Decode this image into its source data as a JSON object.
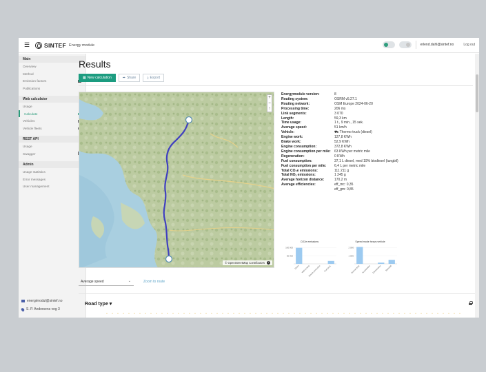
{
  "header": {
    "brand": "SINTEF",
    "module": "Energy module",
    "user": "erlend.dahl@sintef.no",
    "logout": "Log out"
  },
  "sidebar": {
    "sections": [
      {
        "title": "Main",
        "items": [
          {
            "label": "Overview"
          },
          {
            "label": "Method"
          },
          {
            "label": "Emission factors",
            "lock": "dark"
          },
          {
            "label": "Publications"
          }
        ]
      },
      {
        "title": "Web calculator",
        "items": [
          {
            "label": "Usage"
          },
          {
            "label": "Calculate",
            "lock": "green",
            "active": true
          },
          {
            "label": "Vehicles",
            "lock": "dark"
          },
          {
            "label": "Vehicle fleets",
            "lock": "dark"
          }
        ]
      },
      {
        "title": "REST API",
        "items": [
          {
            "label": "Usage"
          },
          {
            "label": "Swagger",
            "ext": true
          }
        ]
      },
      {
        "title": "Admin",
        "items": [
          {
            "label": "Usage statistics"
          },
          {
            "label": "Error messages"
          },
          {
            "label": "User management"
          }
        ]
      }
    ],
    "contact_email": "energimodul@sintef.no",
    "contact_address": "S. P. Andersens veg 3"
  },
  "main": {
    "title": "Results",
    "buttons": {
      "new_calc": "New calculation",
      "share": "Share",
      "export": "Export"
    },
    "map_attribution": "© OpenStreetMap Contributors",
    "speed_select": "Average speed",
    "zoom_link": "Zoom to route",
    "road_type": "Road type"
  },
  "results": [
    {
      "label": "Energymodule version:",
      "value": "8"
    },
    {
      "label": "Routing system:",
      "value": "OSRM v5.27.1"
    },
    {
      "label": "Routing network:",
      "value": "OSM Europe 2024-06-20"
    },
    {
      "label": "Processing time:",
      "value": "206 ms"
    },
    {
      "label": "Link segments:",
      "value": "3 070"
    },
    {
      "label": "Length:",
      "value": "59,3 km"
    },
    {
      "label": "Time usage:",
      "value": "1 t., 9 min., 15 sek."
    },
    {
      "label": "Average speed:",
      "value": "51 km/h"
    },
    {
      "label": "Vehicle:",
      "value": "Thermo truck (diesel)"
    },
    {
      "label": "Engine work:",
      "value": "127,8 KWh"
    },
    {
      "label": "Brake work:",
      "value": "52,9 KWh"
    },
    {
      "label": "Engine consumption:",
      "value": "372,8 KWh"
    },
    {
      "label": "Engine consumption per mile:",
      "value": "63 KWh per metric mile"
    },
    {
      "label": "Regeneration:",
      "value": "0 KWh"
    },
    {
      "label": "Fuel consumption:",
      "value": "37,1 L diesel, med 19% biodiesel (tungbil)"
    },
    {
      "label": "Fuel consumption per mile:",
      "value": "6,4 L per metric mile"
    },
    {
      "label": "Total CO₂e emissions:",
      "value": "111 211 g"
    },
    {
      "label": "Total NOₓ emissions:",
      "value": "1 245 g"
    },
    {
      "label": "Average horizon distance:",
      "value": "170,2 m"
    },
    {
      "label": "Average efficiencies:",
      "value": "eff_mc: 0,35"
    },
    {
      "label": "",
      "value": "eff_gm: 0,85"
    }
  ],
  "chart_data": [
    {
      "type": "bar",
      "title": "CO2e emissions",
      "categories": [
        "Direct",
        "Well-to-tank",
        "Vehicle production",
        "Fuel prod."
      ],
      "values": [
        100000,
        0,
        0,
        18000
      ],
      "yticks": [
        "100 000",
        "50 000"
      ],
      "ylim": [
        0,
        120000
      ]
    },
    {
      "type": "bar",
      "title": "Speed mode heavy vehicle",
      "categories": [
        "Normal drive",
        "Acceleration",
        "Deceleration",
        "Standstill"
      ],
      "values": [
        2100,
        0,
        150,
        500
      ],
      "yticks": [
        "2 000",
        "1 000"
      ],
      "ylim": [
        0,
        2400
      ]
    }
  ]
}
